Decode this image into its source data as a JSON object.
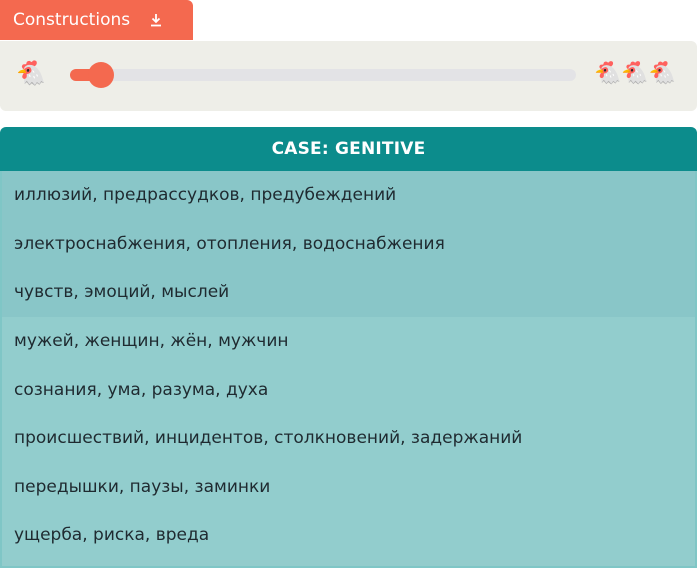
{
  "tab": {
    "label": "Constructions",
    "icon": "download-icon"
  },
  "slider": {
    "left_icon": "🐔",
    "right_icon": "🐔🐔🐔",
    "value_fraction": 0.05,
    "accent": "#f4694f"
  },
  "panel": {
    "header": "CASE: GENITIVE",
    "items": [
      "иллюзий, предрассудков, предубеждений",
      "электроснабжения, отопления, водоснабжения",
      "чувств, эмоций, мыслей",
      "мужей, женщин, жён, мужчин",
      "сознания, ума, разума, духа",
      "происшествий, инцидентов, столкновений, задержаний",
      "передышки, паузы, заминки",
      "ущерба, риска, вреда"
    ]
  },
  "colors": {
    "header": "#0c8c8c",
    "rows": "#93cccc"
  }
}
